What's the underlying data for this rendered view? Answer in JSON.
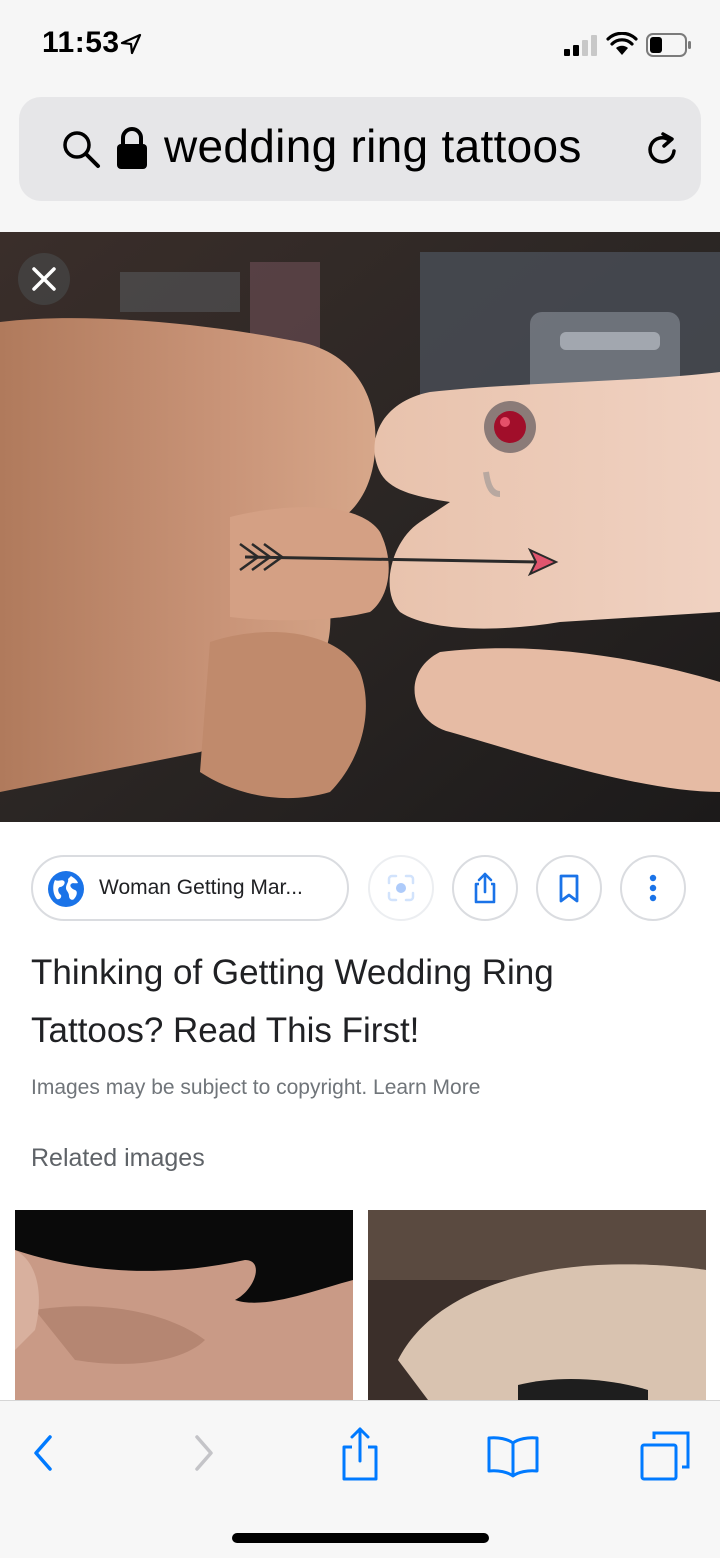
{
  "status_bar": {
    "time": "11:53"
  },
  "url_bar": {
    "query": "wedding ring tattoos"
  },
  "source_chip": {
    "label": "Woman Getting Mar..."
  },
  "result": {
    "title": "Thinking of Getting Wedding Ring Tattoos? Read This First!",
    "copyright_notice": "Images may be subject to copyright.",
    "learn_more": "Learn More"
  },
  "related": {
    "heading": "Related images"
  },
  "colors": {
    "accent": "#1a73e8",
    "ios_blue": "#007aff",
    "chip_border": "#dadce0"
  },
  "icons": {
    "status": [
      "location-arrow-icon",
      "signal-icon",
      "wifi-icon",
      "battery-icon"
    ],
    "url_bar": [
      "search-icon",
      "lock-icon",
      "reload-icon"
    ],
    "actions": [
      "globe-icon",
      "lens-icon",
      "share-icon",
      "bookmark-icon",
      "more-icon"
    ],
    "toolbar": [
      "back-icon",
      "forward-icon",
      "share-icon",
      "bookmarks-icon",
      "tabs-icon"
    ]
  }
}
